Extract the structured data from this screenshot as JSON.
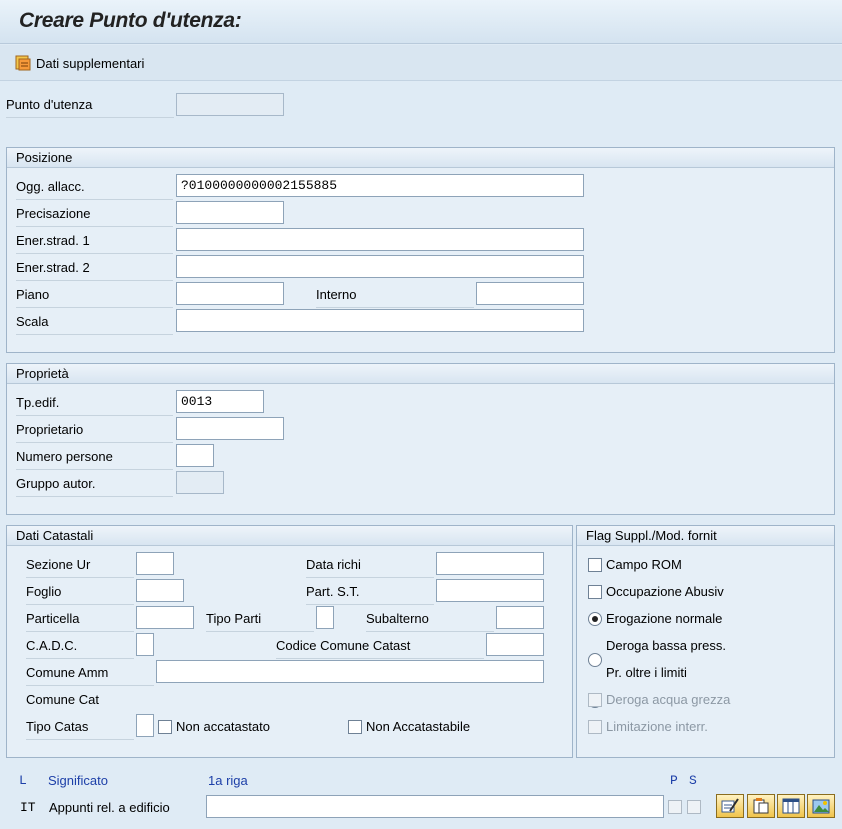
{
  "title": "Creare Punto d'utenza:",
  "toolbar": {
    "dati_supplementari": "Dati supplementari"
  },
  "punto_utenza": {
    "label": "Punto d'utenza",
    "value": ""
  },
  "posizione": {
    "header": "Posizione",
    "ogg_allacc_label": "Ogg. allacc.",
    "ogg_allacc_value": "?0100000000002155885",
    "precisazione_label": "Precisazione",
    "precisazione_value": "",
    "ener1_label": "Ener.strad. 1",
    "ener1_value": "",
    "ener2_label": "Ener.strad. 2",
    "ener2_value": "",
    "piano_label": "Piano",
    "piano_value": "",
    "interno_label": "Interno",
    "interno_value": "",
    "scala_label": "Scala",
    "scala_value": ""
  },
  "proprieta": {
    "header": "Proprietà",
    "tp_edif_label": "Tp.edif.",
    "tp_edif_value": "0013",
    "proprietario_label": "Proprietario",
    "proprietario_value": "",
    "numero_persone_label": "Numero persone",
    "numero_persone_value": "",
    "gruppo_autor_label": "Gruppo autor.",
    "gruppo_autor_value": ""
  },
  "catastali": {
    "header": "Dati Catastali",
    "sezione_ur": "Sezione Ur",
    "data_richi": "Data richi",
    "foglio": "Foglio",
    "part_st": "Part. S.T.",
    "particella": "Particella",
    "tipo_parti": "Tipo Parti",
    "subalterno": "Subalterno",
    "cadc": "C.A.D.C.",
    "codice_comune_catast": "Codice Comune Catast",
    "comune_amm": "Comune Amm",
    "comune_cat": "Comune Cat",
    "tipo_catas": "Tipo Catas",
    "non_accatastato": "Non accatastato",
    "non_accatastabile": "Non Accatastabile"
  },
  "flags": {
    "header": "Flag Suppl./Mod. fornit",
    "campo_rom": "Campo ROM",
    "occupazione_abusiv": "Occupazione Abusiv",
    "erogazione_normale": "Erogazione normale",
    "deroga_bassa": "Deroga bassa press.",
    "pr_oltre": "Pr. oltre i limiti",
    "deroga_acqua": "Deroga acqua grezza",
    "limitazione": "Limitazione interr.",
    "selected_radio": "Erogazione normale"
  },
  "notes": {
    "col_l": "L",
    "col_significato": "Significato",
    "col_riga": "1a riga",
    "col_p": "P",
    "col_s": "S",
    "row_lang": "IT",
    "row_label": "Appunti rel. a edificio",
    "row_value": ""
  },
  "icons": [
    "additional-data-icon",
    "edit-text-icon",
    "new-doc-icon",
    "table-icon",
    "picture-icon"
  ]
}
